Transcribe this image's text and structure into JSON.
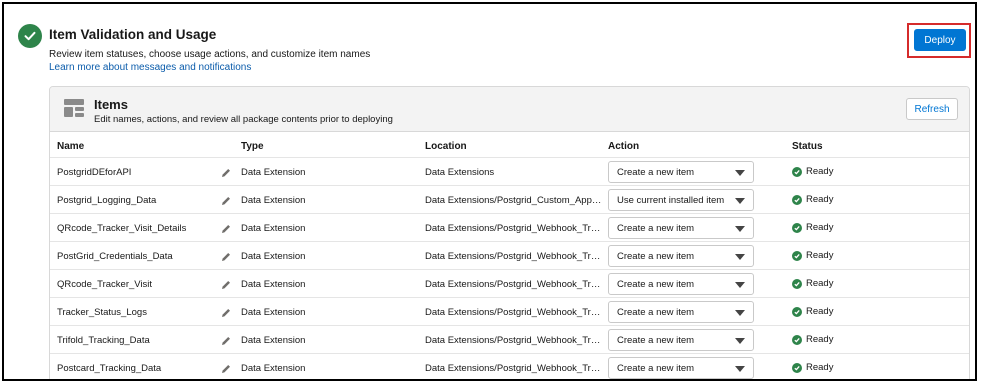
{
  "header": {
    "title": "Item Validation and Usage",
    "subtitle": "Review item statuses, choose usage actions, and customize item names",
    "learn_link": "Learn more about messages and notifications",
    "deploy_label": "Deploy",
    "status_icon": "success-check-icon",
    "accent_color": "#0176d3",
    "success_color": "#2e844a",
    "highlight_color": "#d52b2b"
  },
  "items_card": {
    "title": "Items",
    "subtitle": "Edit names, actions, and review all package contents prior to deploying",
    "refresh_label": "Refresh",
    "icon": "package-items-icon"
  },
  "table": {
    "columns": [
      "Name",
      "Type",
      "Location",
      "Action",
      "Status"
    ],
    "rows": [
      {
        "name": "PostgridDEforAPI",
        "type": "Data Extension",
        "location": "Data Extensions",
        "action": "Create a new item",
        "status": "Ready"
      },
      {
        "name": "Postgrid_Logging_Data",
        "type": "Data Extension",
        "location": "Data Extensions/Postgrid_Custom_App_Tr...",
        "action": "Use current installed item",
        "status": "Ready"
      },
      {
        "name": "QRcode_Tracker_Visit_Details",
        "type": "Data Extension",
        "location": "Data Extensions/Postgrid_Webhook_Tracki...",
        "action": "Create a new item",
        "status": "Ready"
      },
      {
        "name": "PostGrid_Credentials_Data",
        "type": "Data Extension",
        "location": "Data Extensions/Postgrid_Webhook_Tracki...",
        "action": "Create a new item",
        "status": "Ready"
      },
      {
        "name": "QRcode_Tracker_Visit",
        "type": "Data Extension",
        "location": "Data Extensions/Postgrid_Webhook_Tracki...",
        "action": "Create a new item",
        "status": "Ready"
      },
      {
        "name": "Tracker_Status_Logs",
        "type": "Data Extension",
        "location": "Data Extensions/Postgrid_Webhook_Tracki...",
        "action": "Create a new item",
        "status": "Ready"
      },
      {
        "name": "Trifold_Tracking_Data",
        "type": "Data Extension",
        "location": "Data Extensions/Postgrid_Webhook_Tracki...",
        "action": "Create a new item",
        "status": "Ready"
      },
      {
        "name": "Postcard_Tracking_Data",
        "type": "Data Extension",
        "location": "Data Extensions/Postgrid_Webhook_Tracki...",
        "action": "Create a new item",
        "status": "Ready"
      }
    ]
  }
}
